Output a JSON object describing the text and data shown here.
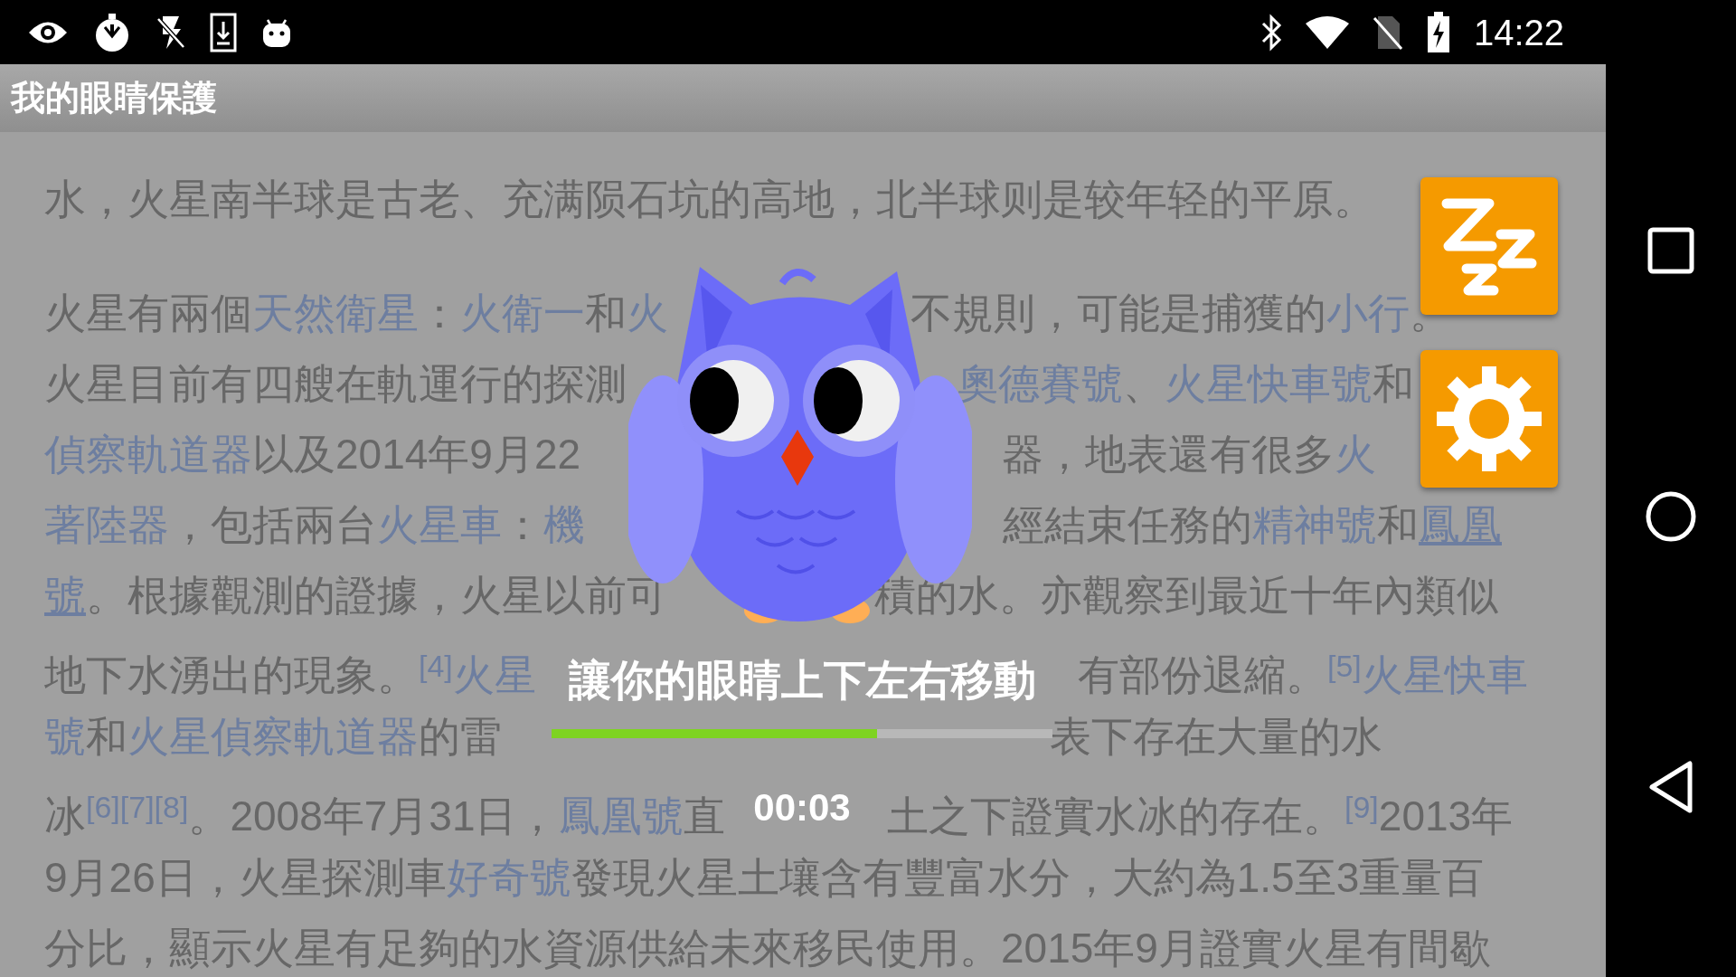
{
  "status_bar": {
    "time": "14:22"
  },
  "app_bar": {
    "title": "我的眼睛保護"
  },
  "article": {
    "rows": [
      {
        "left": [
          {
            "kind": "text",
            "text": "水，火星南半球是古老、充满陨石坑的高地，北半球则是较年轻的平原。"
          }
        ]
      },
      {
        "left": [
          {
            "kind": "text",
            "text": "火星有兩個"
          },
          {
            "kind": "link",
            "text": "天然衛星"
          },
          {
            "kind": "text",
            "text": "："
          },
          {
            "kind": "link",
            "text": "火衛一"
          },
          {
            "kind": "text",
            "text": "和"
          },
          {
            "kind": "link",
            "text": "火"
          }
        ],
        "right": [
          {
            "kind": "text",
            "text": "不規則，可能是捕獲的"
          },
          {
            "kind": "link",
            "text": "小行"
          },
          {
            "kind": "text",
            "text": "。"
          }
        ]
      },
      {
        "left": [
          {
            "kind": "text",
            "text": "火星目前有四艘在軌運行的探測"
          }
        ],
        "right": [
          {
            "kind": "link",
            "text": "奧德賽號"
          },
          {
            "kind": "text",
            "text": "、"
          },
          {
            "kind": "link",
            "text": "火星快車號"
          },
          {
            "kind": "text",
            "text": "和"
          }
        ]
      },
      {
        "left": [
          {
            "kind": "link",
            "text": "偵察軌道器"
          },
          {
            "kind": "text",
            "text": "以及2014年9月22"
          }
        ],
        "right": [
          {
            "kind": "text",
            "text": "器，地表還有很多"
          },
          {
            "kind": "link",
            "text": "火"
          }
        ]
      },
      {
        "left": [
          {
            "kind": "link",
            "text": "著陸器"
          },
          {
            "kind": "text",
            "text": "，包括兩台"
          },
          {
            "kind": "link",
            "text": "火星車"
          },
          {
            "kind": "text",
            "text": "："
          },
          {
            "kind": "link",
            "text": "機"
          }
        ],
        "right": [
          {
            "kind": "text",
            "text": "經結束任務的"
          },
          {
            "kind": "link",
            "text": "精神號"
          },
          {
            "kind": "text",
            "text": "和"
          },
          {
            "kind": "underlined",
            "text": "鳳凰"
          }
        ]
      },
      {
        "left": [
          {
            "kind": "underlined",
            "text": "號"
          },
          {
            "kind": "text",
            "text": "。根據觀測的證據，火星以前可"
          }
        ],
        "right": [
          {
            "kind": "text",
            "text": "積的水。亦觀察到最近十年內類似"
          }
        ]
      },
      {
        "left": [
          {
            "kind": "text",
            "text": "地下水湧出的現象。"
          },
          {
            "kind": "ref",
            "text": "[4]"
          },
          {
            "kind": "link",
            "text": "火星"
          }
        ],
        "right": [
          {
            "kind": "text",
            "text": "有部份退縮。"
          },
          {
            "kind": "ref",
            "text": "[5]"
          },
          {
            "kind": "link",
            "text": "火星快車"
          }
        ]
      },
      {
        "left": [
          {
            "kind": "link",
            "text": "號"
          },
          {
            "kind": "text",
            "text": "和"
          },
          {
            "kind": "link",
            "text": "火星偵察軌道器"
          },
          {
            "kind": "text",
            "text": "的雷"
          }
        ],
        "right": [
          {
            "kind": "text",
            "text": "表下存在大量的水"
          }
        ]
      },
      {
        "left": [
          {
            "kind": "text",
            "text": "冰"
          },
          {
            "kind": "ref",
            "text": "[6][7][8]"
          },
          {
            "kind": "text",
            "text": "。2008年7月31日，"
          },
          {
            "kind": "link",
            "text": "鳳凰號"
          },
          {
            "kind": "text",
            "text": "直"
          }
        ],
        "right": [
          {
            "kind": "text",
            "text": "土之下證實水冰的存在。"
          },
          {
            "kind": "ref",
            "text": "[9]"
          },
          {
            "kind": "text",
            "text": "2013年"
          }
        ]
      },
      {
        "left": [
          {
            "kind": "text",
            "text": "9月26日，火星探測車"
          },
          {
            "kind": "link",
            "text": "好奇號"
          },
          {
            "kind": "text",
            "text": "發現火星土壤含有豐富水分，大約為1.5至3重量百"
          }
        ]
      },
      {
        "left": [
          {
            "kind": "text",
            "text": "分比，顯示火星有足夠的水資源供給未來移民使用。2015年9月證實火星有間歇"
          }
        ]
      }
    ]
  },
  "side_buttons": [
    {
      "kind": "sleep"
    },
    {
      "kind": "settings"
    }
  ],
  "exercise": {
    "instruction": "讓你的眼睛上下左右移動",
    "level": 0.65,
    "timer": "00:03"
  }
}
